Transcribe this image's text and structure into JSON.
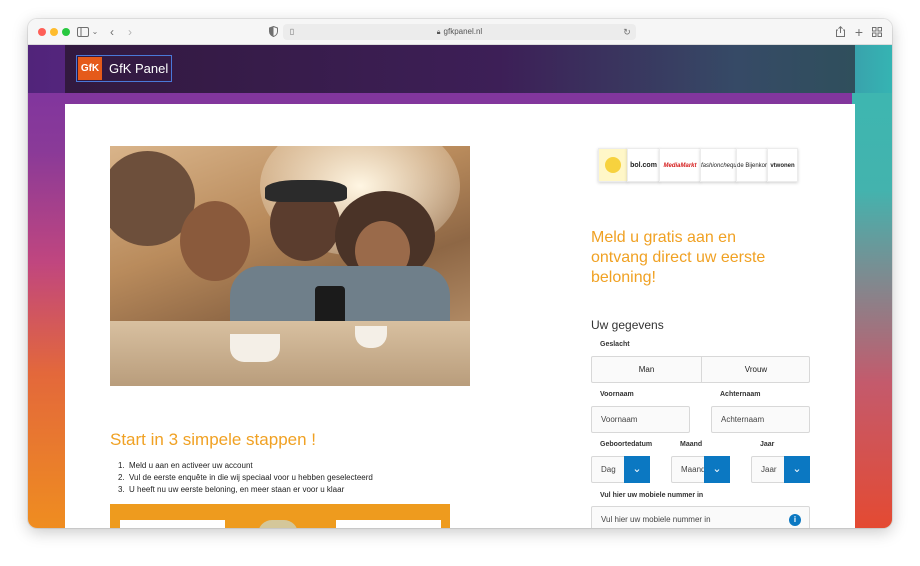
{
  "browser": {
    "url": "gfkpanel.nl",
    "icons": [
      "sidebar-icon",
      "chevron-down-icon",
      "back-icon",
      "forward-icon",
      "shield-icon",
      "page-icon",
      "lock-icon",
      "reload-icon",
      "share-icon",
      "new-tab-icon",
      "tab-overview-icon"
    ]
  },
  "header": {
    "logo_mark": "GfK",
    "logo_text": "GfK Panel"
  },
  "hero": {
    "image": "group-of-friends-with-phone-photo"
  },
  "steps": {
    "title": "Start in 3 simpele stappen !",
    "items": [
      {
        "num": "1.",
        "text": "Meld u aan en activeer uw account"
      },
      {
        "num": "2.",
        "text": "Vul de eerste enquête in die wij speciaal voor u hebben geselecteerd"
      },
      {
        "num": "3.",
        "text": "U heeft nu uw eerste beloning, en meer staan er voor u klaar"
      }
    ]
  },
  "partners": [
    "",
    "bol.com",
    "MediaMarkt",
    "fashioncheque",
    "de Bijenkorf",
    "vtwonen"
  ],
  "form": {
    "title": "Meld u gratis aan en ontvang direct uw eerste beloning!",
    "section": "Uw gegevens",
    "gender_label": "Geslacht",
    "gender_options": [
      "Man",
      "Vrouw"
    ],
    "firstname_label": "Voornaam",
    "firstname_placeholder": "Voornaam",
    "lastname_label": "Achternaam",
    "lastname_placeholder": "Achternaam",
    "dob_label": "Geboortedatum",
    "month_label": "Maand",
    "year_label": "Jaar",
    "day_value": "Dag",
    "month_value": "Maand",
    "year_value": "Jaar",
    "mobile_label": "Vul hier uw mobiele nummer in",
    "mobile_placeholder": "Vul hier uw mobiele nummer in"
  },
  "colors": {
    "accent_orange": "#f0a123",
    "button_blue": "#0b78c2",
    "logo_orange": "#e55a1a"
  }
}
